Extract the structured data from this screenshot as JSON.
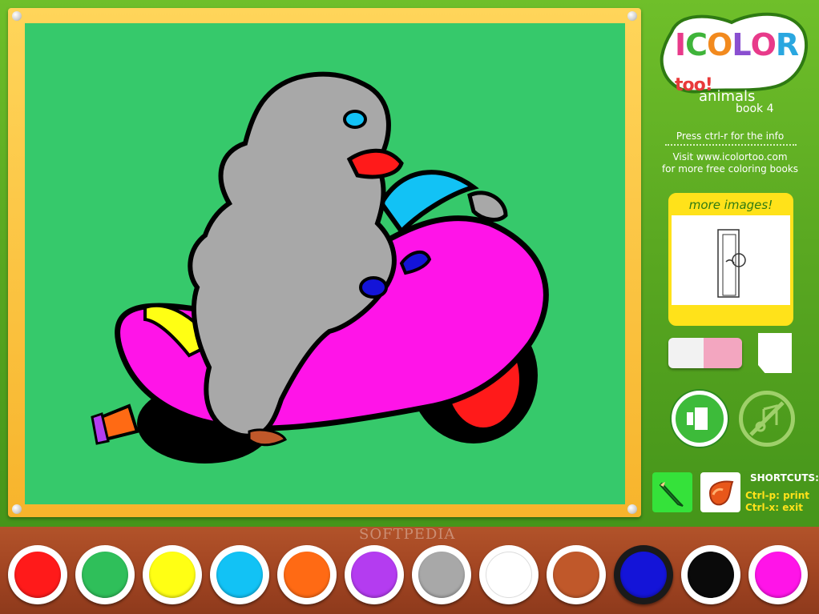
{
  "logo": {
    "letters": [
      "I",
      "C",
      "O",
      "L",
      "O",
      "R",
      "too!"
    ],
    "colors": [
      "#e83a8a",
      "#3fb43a",
      "#f28a1e",
      "#8a4fd0",
      "#e83a8a",
      "#2aa7e0",
      "#e83a3a"
    ]
  },
  "book": {
    "title": "animals",
    "subtitle": "book 4"
  },
  "info": {
    "line1": "Press ctrl-r for the info",
    "line2": "Visit www.icolortoo.com",
    "line3": "for more free coloring books"
  },
  "more_images": {
    "label": "more images!"
  },
  "shortcuts": {
    "title": "SHORTCUTS:",
    "print": "Ctrl-p: print",
    "exit": "Ctrl-x: exit"
  },
  "watermark": "SOFTPEDIA",
  "palette": [
    {
      "name": "red",
      "hex": "#ff1a1a"
    },
    {
      "name": "green",
      "hex": "#2fbf5a"
    },
    {
      "name": "yellow",
      "hex": "#ffff14"
    },
    {
      "name": "cyan",
      "hex": "#12c2f5"
    },
    {
      "name": "orange",
      "hex": "#ff6a14"
    },
    {
      "name": "purple",
      "hex": "#b43cf0"
    },
    {
      "name": "gray",
      "hex": "#a8a8a8"
    },
    {
      "name": "white",
      "hex": "#ffffff"
    },
    {
      "name": "brown",
      "hex": "#c0582a"
    },
    {
      "name": "blue",
      "hex": "#1414d8",
      "selected": true
    },
    {
      "name": "black",
      "hex": "#0a0a0a"
    },
    {
      "name": "magenta",
      "hex": "#ff14e8"
    }
  ],
  "canvas": {
    "background": "#36c96b"
  }
}
